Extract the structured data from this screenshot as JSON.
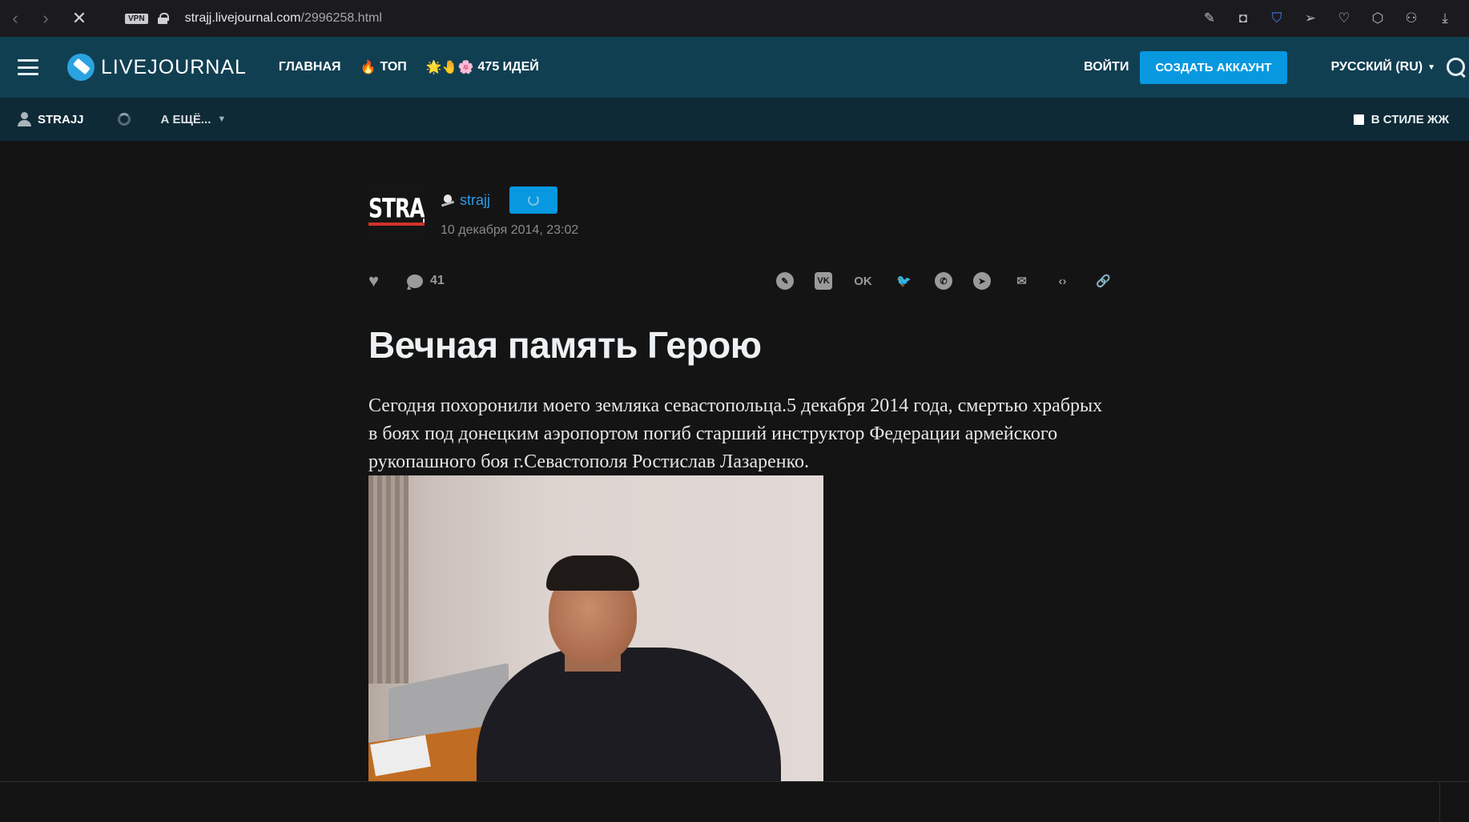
{
  "browser": {
    "url_host": "strajj.livejournal.com",
    "url_path": "/2996258.html",
    "vpn_label": "VPN"
  },
  "header": {
    "logo_text": "LIVEJOURNAL",
    "nav": {
      "home": "ГЛАВНАЯ",
      "top_emoji": "🔥",
      "top": "ТОП",
      "ideas_emoji": "🌟🤚🌸",
      "ideas": "475 ИДЕЙ"
    },
    "login": "ВОЙТИ",
    "create_account": "СОЗДАТЬ АККАУНТ",
    "language": "РУССКИЙ (RU)",
    "accent_color": "#0798e0",
    "bg_color": "#113f52"
  },
  "subheader": {
    "user": "STRAJJ",
    "more": "А ЕЩЁ...",
    "style_toggle": "В СТИЛЕ ЖЖ"
  },
  "post": {
    "avatar_text": "STRAJJ",
    "author": "strajj",
    "date": "10 декабря 2014, 23:02",
    "comment_count": "41",
    "share_vk": "VK",
    "share_ok": "OK",
    "title": "Вечная память Герою",
    "body": "Сегодня похоронили моего земляка севастопольца.5 декабря 2014 года, смертью храбрых в боях под донецким аэропортом погиб старший инструктор Федерации армейского рукопашного боя г.Севастополя Ростислав Лазаренко."
  }
}
